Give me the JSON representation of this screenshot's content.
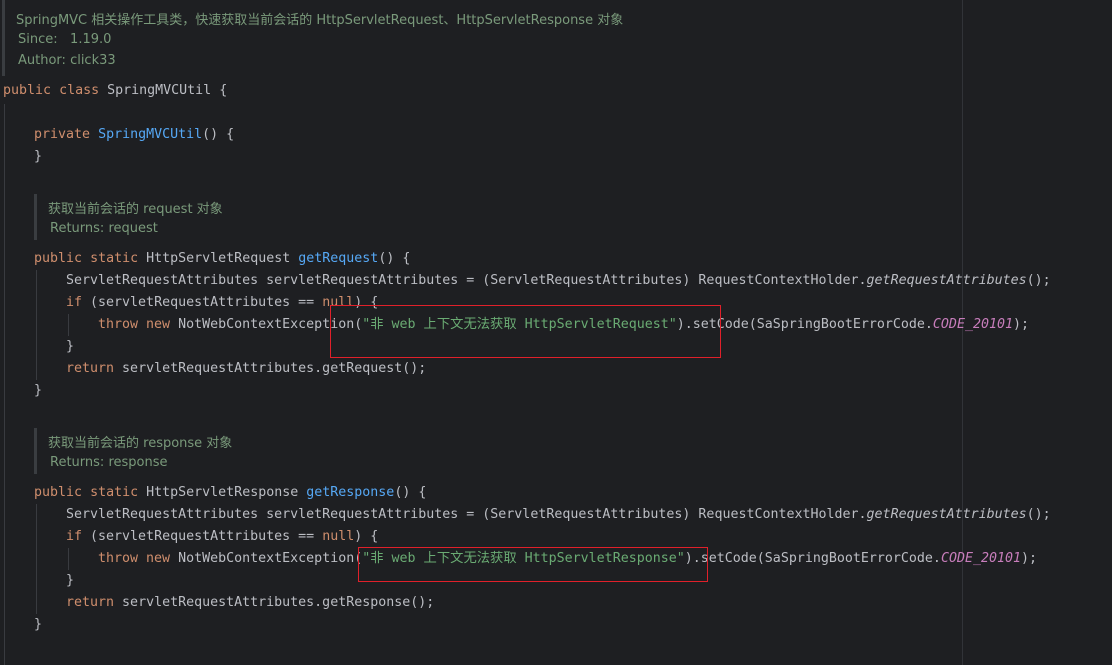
{
  "class_doc": {
    "description": "SpringMVC 相关操作工具类，快速获取当前会话的 HttpServletRequest、HttpServletResponse 对象",
    "since_label": "Since:",
    "since_value": "1.19.0",
    "author_label": "Author:",
    "author_value": "click33"
  },
  "get_request_doc": {
    "description": "获取当前会话的 request 对象",
    "returns_label": "Returns:",
    "returns_value": "request"
  },
  "get_response_doc": {
    "description": "获取当前会话的 response 对象",
    "returns_label": "Returns:",
    "returns_value": "response"
  },
  "code": {
    "kw_public": "public",
    "kw_class": "class",
    "kw_private": "private",
    "kw_static": "static",
    "kw_if": "if",
    "kw_null": "null",
    "kw_throw": "throw",
    "kw_new": "new",
    "kw_return": "return",
    "class_name": "SpringMVCUtil",
    "open_brace": " {",
    "close_brace": "}",
    "ctor_parens": "() {",
    "type_request": "HttpServletRequest",
    "type_response": "HttpServletResponse",
    "method_get_request": "getRequest",
    "method_get_response": "getResponse",
    "method_parens": "() {",
    "attrs_decl": "ServletRequestAttributes servletRequestAttributes = (ServletRequestAttributes) RequestContextHolder.",
    "get_request_attributes": "getRequestAttributes",
    "call_end": "();",
    "if_cond": " (servletRequestAttributes == ",
    "if_cond_end": ") {",
    "exception_open": "NotWebContextException(",
    "request_error_message": "\"非 web 上下文无法获取 HttpServletRequest\"",
    "response_error_message": "\"非 web 上下文无法获取 HttpServletResponse\"",
    "set_code": ").setCode(SaSpringBootErrorCode.",
    "error_code_constant": "CODE_20101",
    "stmt_end": ");",
    "return_request": " servletRequestAttributes.getRequest();",
    "return_response": " servletRequestAttributes.getResponse();"
  },
  "colors": {
    "background": "#1e1f22",
    "keyword": "#cf8e6d",
    "function": "#56a8f5",
    "string": "#6aab73",
    "constant": "#c77dbb",
    "doc_comment": "#7a9a7b",
    "highlight_box": "#e0202a"
  }
}
